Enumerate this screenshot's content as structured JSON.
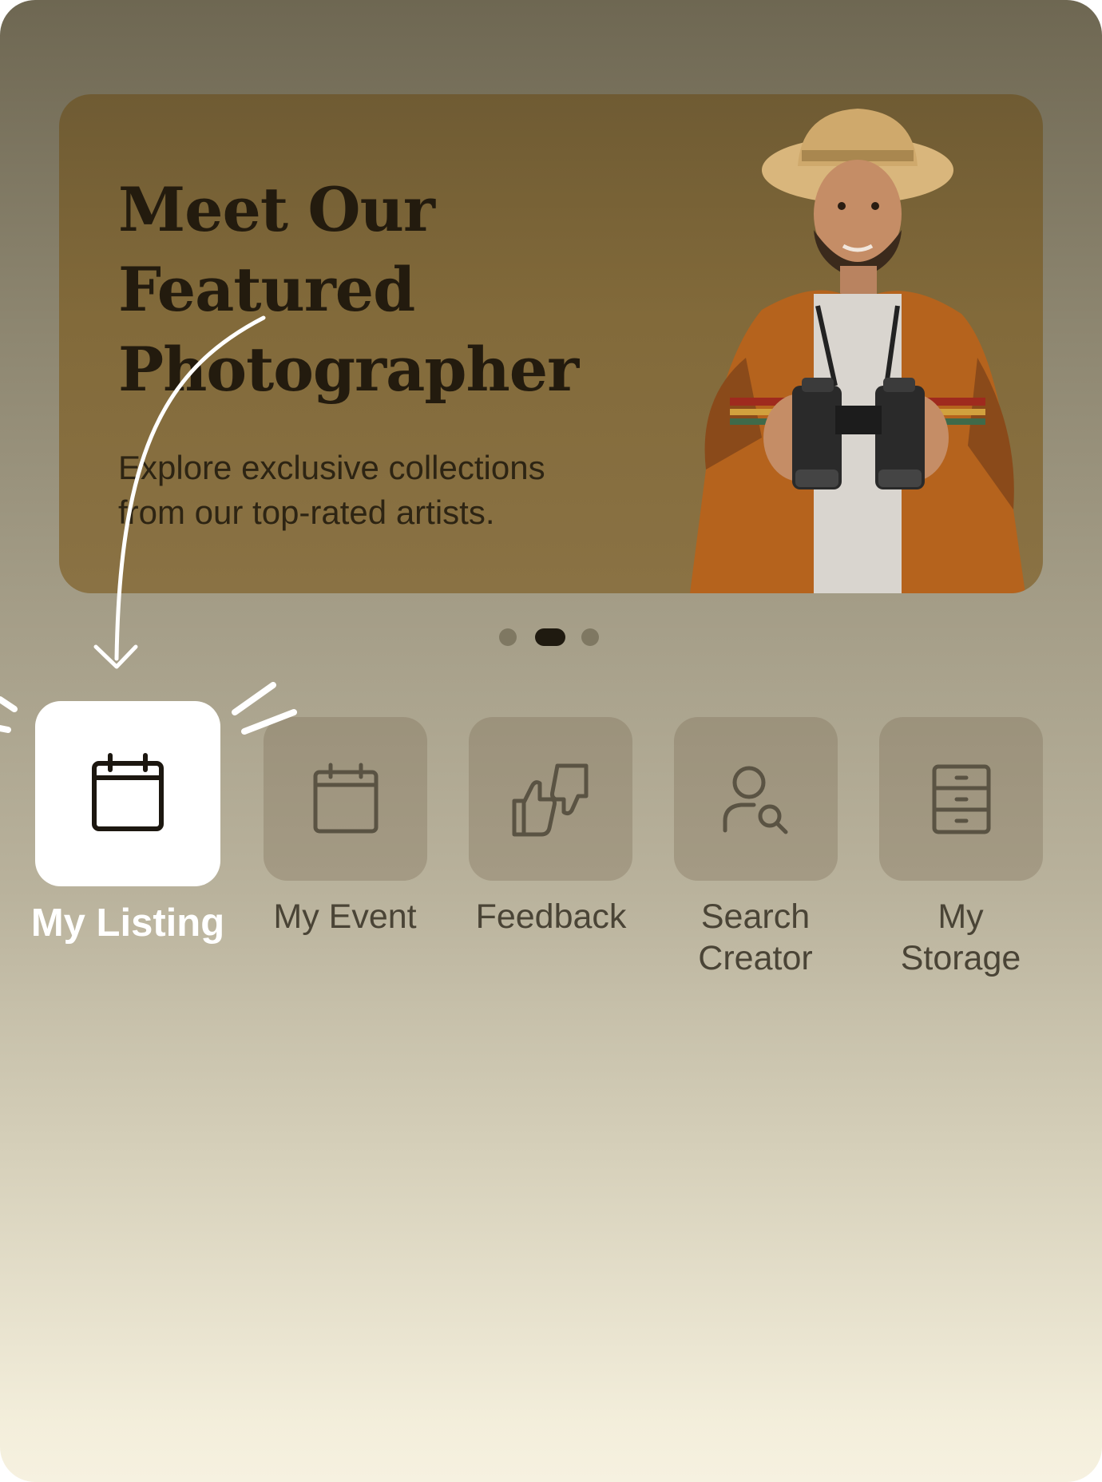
{
  "banner": {
    "title_line1": "Meet Our",
    "title_line2": "Featured",
    "title_line3": "Photographer",
    "subtitle_line1": "Explore exclusive collections",
    "subtitle_line2": "from our top-rated artists."
  },
  "carousel": {
    "total": 3,
    "active_index": 1
  },
  "quick_actions": [
    {
      "label": "My Listing",
      "icon": "calendar-icon",
      "highlighted": true
    },
    {
      "label": "My Event",
      "icon": "calendar-icon",
      "highlighted": false
    },
    {
      "label": "Feedback",
      "icon": "thumbs-up-down-icon",
      "highlighted": false
    },
    {
      "label_line1": "Search",
      "label_line2": "Creator",
      "icon": "user-search-icon",
      "highlighted": false
    },
    {
      "label_line1": "My",
      "label_line2": "Storage",
      "icon": "cabinet-icon",
      "highlighted": false
    }
  ],
  "colors": {
    "active_tile": "#ffffff",
    "active_dot": "#1f1a10",
    "inactive_dot": "#7f7862",
    "banner_text": "#231b0e"
  }
}
